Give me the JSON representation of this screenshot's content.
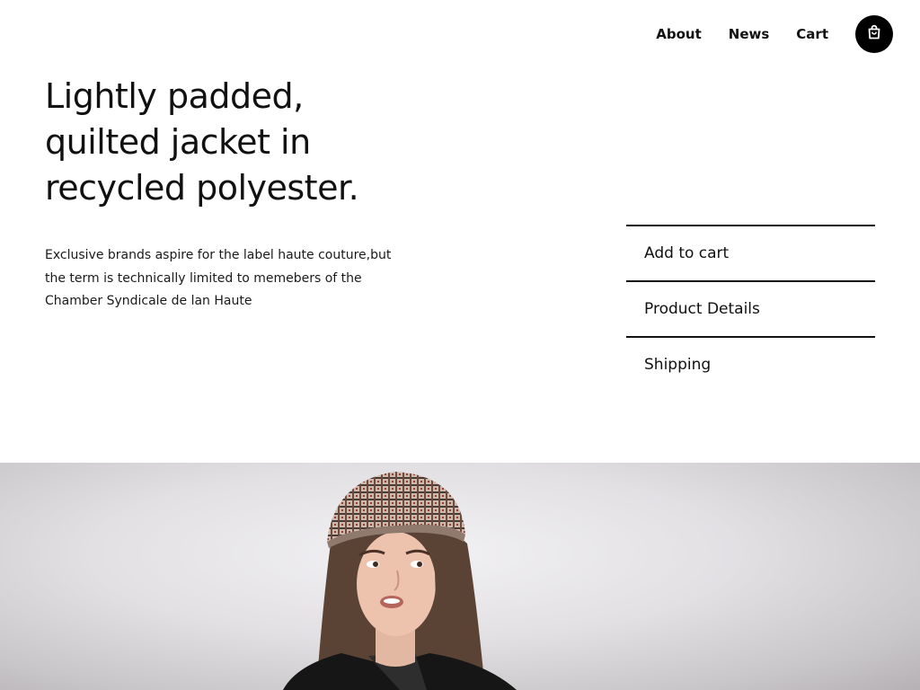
{
  "nav": {
    "links": [
      "About",
      "News",
      "Cart"
    ],
    "cart_icon": "shopping-bag-icon"
  },
  "hero": {
    "headline_lines": [
      "Lightly padded,",
      "quilted jacket in",
      "recycled polyester."
    ],
    "description": "Exclusive brands aspire for the label haute couture,but the term is technically limited to memebers of the Chamber Syndicale de lan Haute"
  },
  "actions": {
    "items": [
      "Add to cart",
      "Product Details",
      "Shipping"
    ]
  },
  "image": {
    "subject": "woman-in-plaid-beret-and-leather-jacket"
  },
  "colors": {
    "text": "#111111",
    "background": "#ffffff",
    "button_bg": "#000000"
  }
}
